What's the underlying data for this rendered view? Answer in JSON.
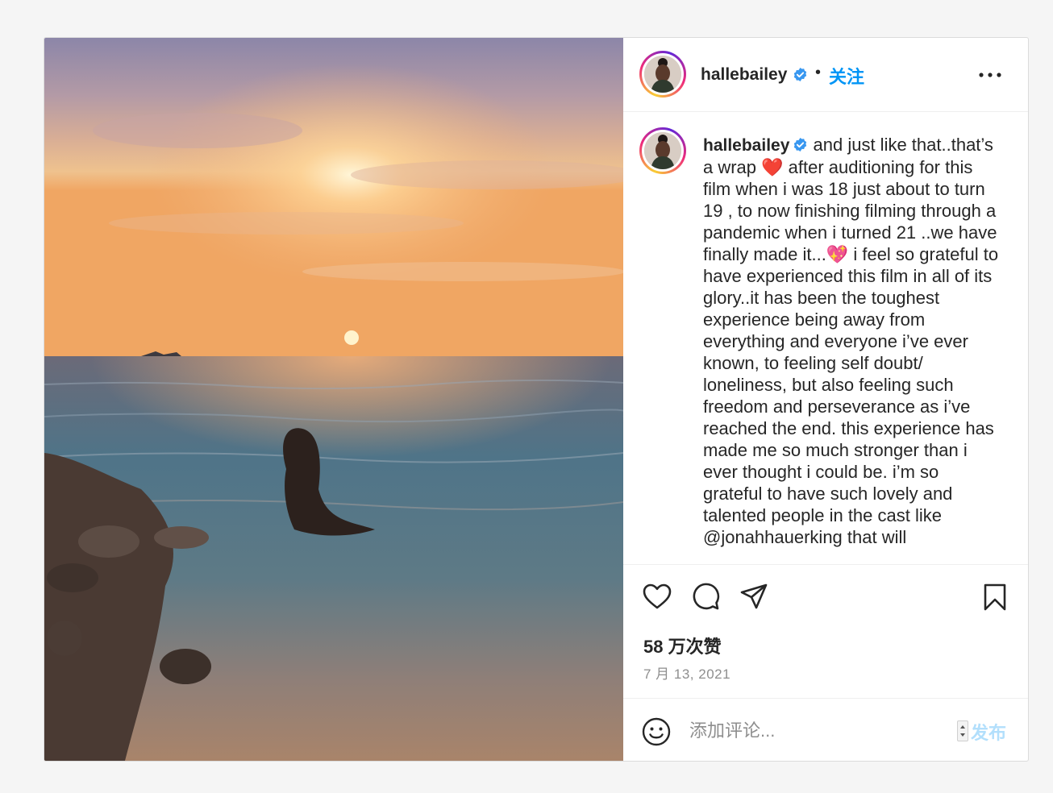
{
  "post": {
    "username": "hallebailey",
    "follow_label": "关注",
    "separator": "•",
    "caption": "and just like that..that’s a wrap ❤️ after auditioning for this film when i was 18 just about to turn 19 , to now finishing filming through a pandemic when i turned 21 ..we have finally made it...💖 i feel so grateful to have experienced this film in all of its glory..it has been the toughest experience being away from everything and everyone i’ve ever known, to feeling self doubt/ loneliness, but also feeling such freedom and perseverance as i’ve reached the end. this experience has made me so much stronger than i ever thought i could be. i’m so grateful to have such lovely and talented people in the cast like @jonahhauerking that will",
    "likes": "58 万次赞",
    "date": "7 月 13, 2021"
  },
  "comment": {
    "placeholder": "添加评论...",
    "post_label": "发布"
  },
  "icons": {
    "verified": "verified-badge-icon",
    "more": "more-options-icon",
    "like": "heart-icon",
    "comment": "comment-icon",
    "share": "share-icon",
    "save": "bookmark-icon",
    "emoji": "emoji-icon"
  },
  "colors": {
    "accent": "#0095f6",
    "post_disabled": "#b2dffc",
    "muted": "#8e8e8e"
  }
}
